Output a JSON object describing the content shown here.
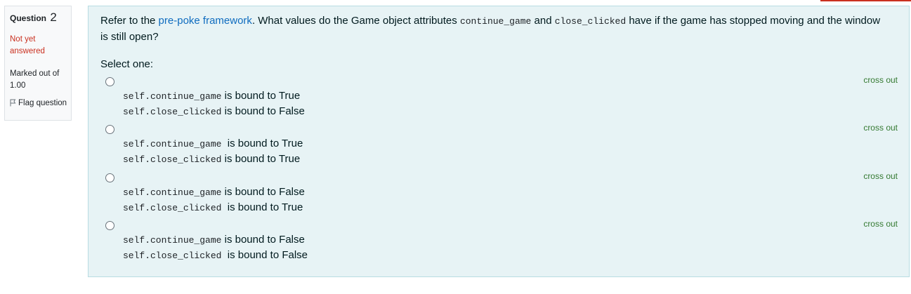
{
  "question": {
    "label": "Question",
    "number": "2",
    "state": "Not yet answered",
    "grade": "Marked out of 1.00",
    "flag_label": "Flag question"
  },
  "text": {
    "p1": "Refer to the ",
    "link": "pre-poke framework",
    "p2": ". What values do the Game object attributes ",
    "code1": "continue_game",
    "p3": " and ",
    "code2": "close_clicked",
    "p4": " have if the game has stopped moving and the window is still open?"
  },
  "prompt": "Select one:",
  "cross_out_label": "cross out",
  "options": [
    {
      "line1_code": "self.continue_game",
      "line1_text": " is bound to True",
      "line2_code": "self.close_clicked",
      "line2_text": " is bound to False"
    },
    {
      "line1_code": "self.continue_game",
      "line1_text": "  is bound to True",
      "line2_code": "self.close_clicked",
      "line2_text": " is bound to True"
    },
    {
      "line1_code": "self.continue_game",
      "line1_text": " is bound to False",
      "line2_code": "self.close_clicked",
      "line2_text": "  is bound to True"
    },
    {
      "line1_code": "self.continue_game",
      "line1_text": " is bound to False",
      "line2_code": "self.close_clicked",
      "line2_text": "  is bound to False"
    }
  ],
  "colors": {
    "state": "#ca3120",
    "link": "#0f6cbf",
    "cross_out": "#357a32",
    "panel": "#e7f3f5"
  }
}
